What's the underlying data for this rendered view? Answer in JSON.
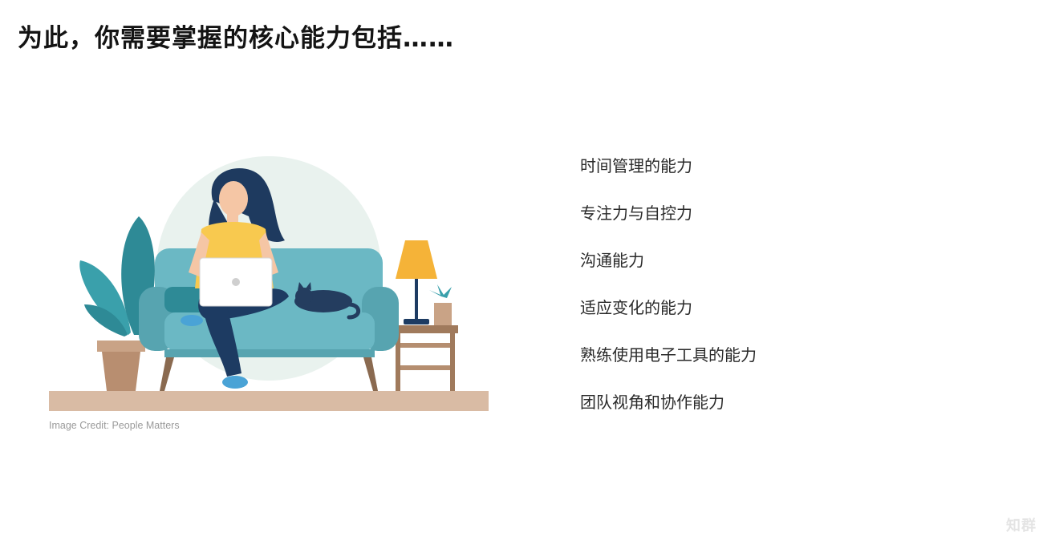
{
  "slide": {
    "title": "为此，你需要掌握的核心能力包括……",
    "image_credit": "Image Credit: People Matters",
    "abilities": [
      "时间管理的能力",
      "专注力与自控力",
      "沟通能力",
      "适应变化的能力",
      "熟练使用电子工具的能力",
      "团队视角和协作能力"
    ],
    "watermark": "知群"
  },
  "illustration": {
    "subject": "woman working on laptop sitting on sofa with cat, plant and lamp",
    "colors": {
      "backdrop_circle": "#e9f2ee",
      "floor": "#d9bba4",
      "sofa": "#6bb8c4",
      "sofa_dark": "#57a4b0",
      "hair": "#1e3a5f",
      "skin": "#f5c6a5",
      "shirt": "#f8c94f",
      "pants": "#1d3b62",
      "laptop": "#ffffff",
      "plant_dark": "#2e8a96",
      "plant_light": "#3aa0ab",
      "pot": "#b88e70",
      "table": "#a07a5c",
      "lamp_shade": "#f5b338",
      "cat": "#243d5f",
      "shoe": "#4aa3d6"
    }
  }
}
